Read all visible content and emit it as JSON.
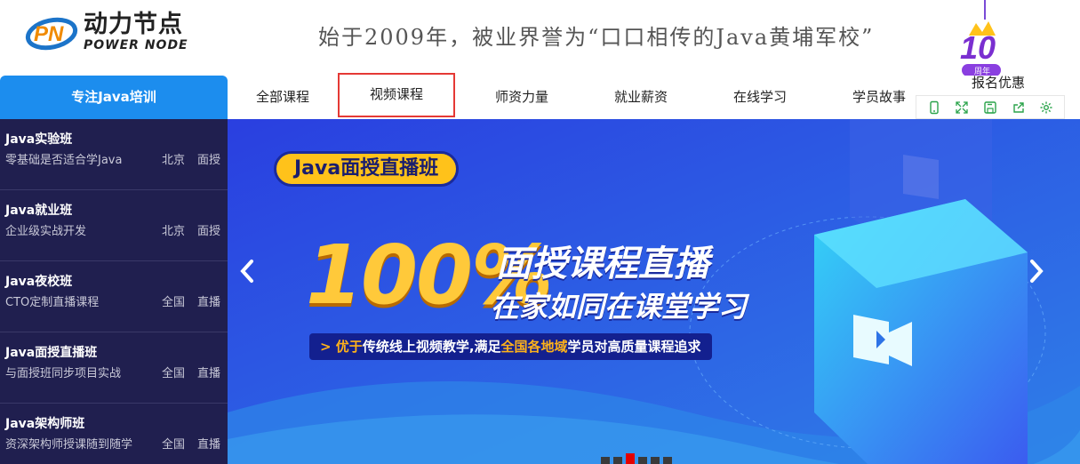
{
  "brand": {
    "name_cn": "动力节点",
    "name_en": "POWER NODE",
    "mark": "PN",
    "slogan": "始于2009年，被业界誉为“口口相传的Java黄埔军校”",
    "anniversary": "10",
    "anniversary_label": "周年"
  },
  "nav": {
    "focus_label": "专注Java培训",
    "items": [
      {
        "label": "全部课程"
      },
      {
        "label": "视频课程"
      },
      {
        "label": "师资力量"
      },
      {
        "label": "就业薪资"
      },
      {
        "label": "在线学习"
      },
      {
        "label": "学员故事"
      },
      {
        "label": "报名优惠"
      }
    ],
    "active_index": 1
  },
  "toolbar": {
    "icons": [
      "phone-icon",
      "fullscreen-icon",
      "save-icon",
      "share-icon",
      "settings-icon"
    ]
  },
  "sidebar": {
    "courses": [
      {
        "title": "Java实验班",
        "desc": "零基础是否适合学Java",
        "tags": [
          "北京",
          "面授"
        ]
      },
      {
        "title": "Java就业班",
        "desc": "企业级实战开发",
        "tags": [
          "北京",
          "面授"
        ]
      },
      {
        "title": "Java夜校班",
        "desc": "CTO定制直播课程",
        "tags": [
          "全国",
          "直播"
        ]
      },
      {
        "title": "Java面授直播班",
        "desc": "与面授班同步项目实战",
        "tags": [
          "全国",
          "直播"
        ]
      },
      {
        "title": "Java架构师班",
        "desc": "资深架构师授课随到随学",
        "tags": [
          "全国",
          "直播"
        ]
      }
    ]
  },
  "banner": {
    "pill": "Java面授直播班",
    "percent": "100%",
    "headline": "面授课程直播",
    "subheadline": "在家如同在课堂学习",
    "promo_prefix": "> ",
    "promo_hl1": "优于",
    "promo_mid": "传统线上视频教学,满足",
    "promo_hl2": "全国各地域",
    "promo_tail": "学员对高质量课程追求",
    "slide_count": 6,
    "active_slide": 2,
    "colors": {
      "accent": "#ffc21a",
      "bg": "#1f3bd6",
      "nav_active": "#1c8dee",
      "active_border": "#e53935"
    }
  }
}
